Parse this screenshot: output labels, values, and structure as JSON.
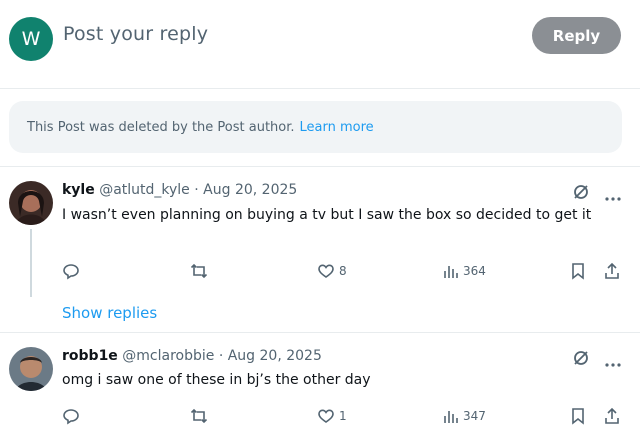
{
  "composer": {
    "avatar_letter": "W",
    "avatar_color": "#10826e",
    "placeholder": "Post your reply",
    "reply_label": "Reply"
  },
  "deleted_notice": {
    "text": "This Post was deleted by the Post author.",
    "link": "Learn more"
  },
  "replies": [
    {
      "name": "kyle",
      "handle": "@atlutd_kyle",
      "separator": "·",
      "date": "Aug 20, 2025",
      "text": "I wasn’t even planning on buying a tv but I saw the box so decided to get it",
      "likes": "8",
      "views": "364",
      "show_replies": "Show replies"
    },
    {
      "name": "robb1e",
      "handle": "@mclarobbie",
      "separator": "·",
      "date": "Aug 20, 2025",
      "text": "omg i saw one of these in bj’s the other day",
      "likes": "1",
      "views": "347"
    }
  ],
  "icons": [
    "grok-icon",
    "more-icon",
    "reply-icon",
    "repost-icon",
    "like-icon",
    "views-icon",
    "bookmark-icon",
    "share-icon"
  ],
  "colors": {
    "link": "#1d9bf0",
    "muted": "#536471",
    "reply_button": "#8b8f94"
  }
}
